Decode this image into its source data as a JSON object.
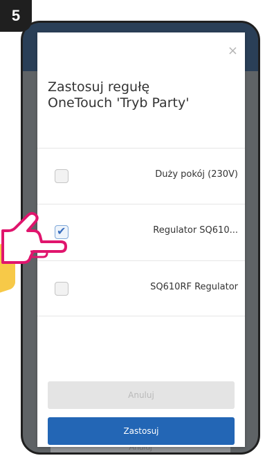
{
  "step": {
    "number": "5"
  },
  "modal": {
    "close_glyph": "×",
    "title_line1": "Zastosuj regułę",
    "title_line2": "OneTouch 'Tryb Party'",
    "devices": [
      {
        "label": "Duży pokój (230V)",
        "checked": false
      },
      {
        "label": "Regulator SQ610...",
        "checked": true
      },
      {
        "label": "SQ610RF Regulator",
        "checked": false
      }
    ],
    "cancel_label": "Anuluj",
    "apply_label": "Zastosuj"
  },
  "background": {
    "bottom_button_label": "Anuluj"
  },
  "colors": {
    "accent_yellow": "#f7c948",
    "hand_magenta": "#e0156d",
    "apply_blue": "#2366b5"
  },
  "icons": {
    "hand": "pointing-hand-icon",
    "close": "close-icon",
    "check": "checkmark-icon"
  }
}
